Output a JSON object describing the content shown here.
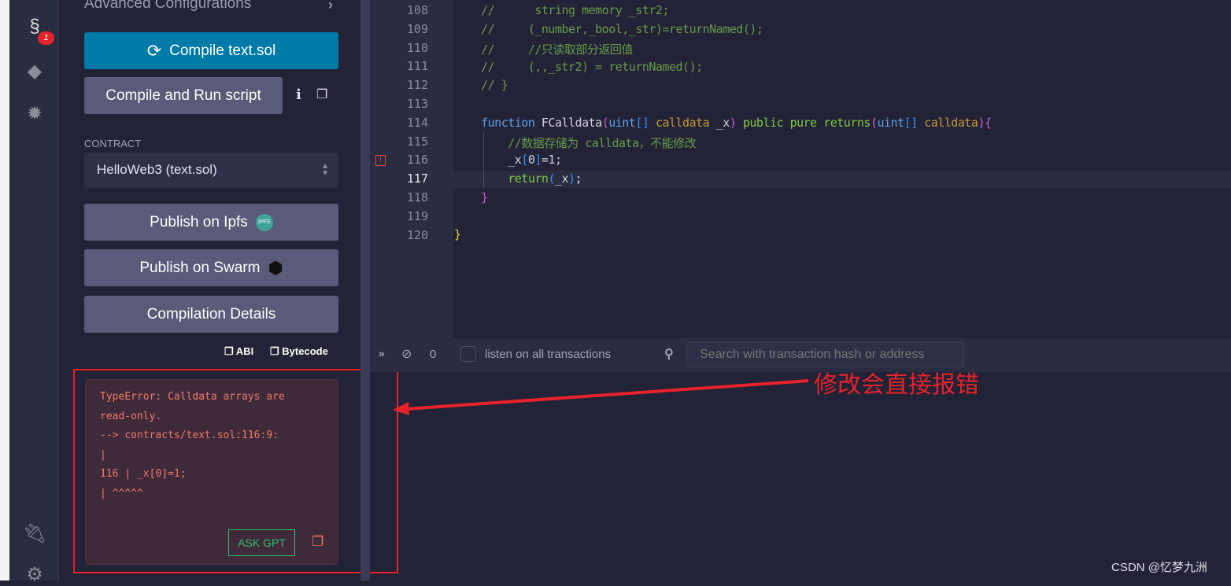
{
  "iconbar": {
    "badge": "1",
    "icons": [
      "solidity-compiler-icon",
      "deploy-ethereum-icon",
      "debugger-bug-icon",
      "plugin-icon",
      "settings-gear-icon"
    ]
  },
  "panel": {
    "advanced": "Advanced Configurations",
    "compile": "Compile text.sol",
    "compile_run": "Compile and Run script",
    "contract_label": "CONTRACT",
    "contract_value": "HelloWeb3 (text.sol)",
    "publish_ipfs": "Publish on Ipfs",
    "ipfs_badge": "IPFS",
    "publish_swarm": "Publish on Swarm",
    "details": "Compilation Details",
    "abi": "ABI",
    "bytecode": "Bytecode",
    "error": {
      "lines": [
        "TypeError: Calldata arrays are",
        "read-only.",
        "--> contracts/text.sol:116:9:",
        "|",
        "116 | _x[0]=1;",
        "| ^^^^^"
      ],
      "ask_gpt": "ASK GPT"
    }
  },
  "editor": {
    "line_numbers": [
      "108",
      "109",
      "110",
      "111",
      "112",
      "113",
      "114",
      "115",
      "116",
      "117",
      "118",
      "119",
      "120"
    ],
    "active_line": "117",
    "error_line": "116"
  },
  "terminal": {
    "count": "0",
    "listen_label": "listen on all transactions",
    "search_placeholder": "Search with transaction hash or address"
  },
  "annotation": {
    "text": "修改会直接报错",
    "color": "#e8222a"
  },
  "watermark": "CSDN @忆梦九洲",
  "colors": {
    "accent": "#007aa6",
    "button": "#595b78",
    "error_text": "#f07a6a",
    "ask_gpt": "#2fbf71"
  }
}
